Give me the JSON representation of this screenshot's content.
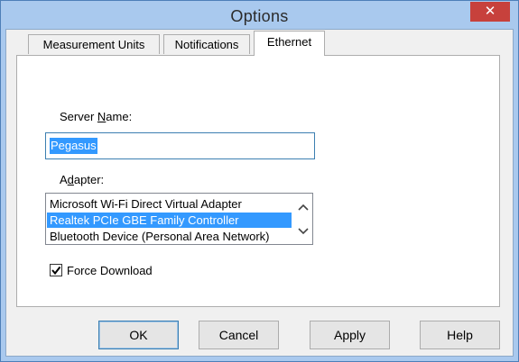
{
  "window": {
    "title": "Options",
    "close_glyph": "✕",
    "title_bar_color": "#a9c9ee",
    "close_button_color": "#c7413c"
  },
  "tabs": [
    {
      "label": "Measurement Units",
      "active": false
    },
    {
      "label": "Notifications",
      "active": false
    },
    {
      "label": "Ethernet",
      "active": true
    }
  ],
  "ethernet": {
    "server_name": {
      "label_pre": "Server ",
      "label_mnemonic": "N",
      "label_post": "ame:",
      "value": "Pegasus"
    },
    "adapter": {
      "label_pre": "A",
      "label_mnemonic": "d",
      "label_post": "apter:",
      "options": [
        {
          "label": "Microsoft Wi-Fi Direct Virtual Adapter",
          "selected": false
        },
        {
          "label": "Realtek PCIe GBE Family Controller",
          "selected": true
        },
        {
          "label": "Bluetooth Device (Personal Area Network)",
          "selected": false
        }
      ]
    },
    "force_download": {
      "label": "Force Download",
      "checked": true
    }
  },
  "buttons": {
    "ok": "OK",
    "cancel": "Cancel",
    "apply": "Apply",
    "help": "Help"
  },
  "colors": {
    "selection": "#3399ff",
    "focus_border": "#3c7fb1"
  }
}
